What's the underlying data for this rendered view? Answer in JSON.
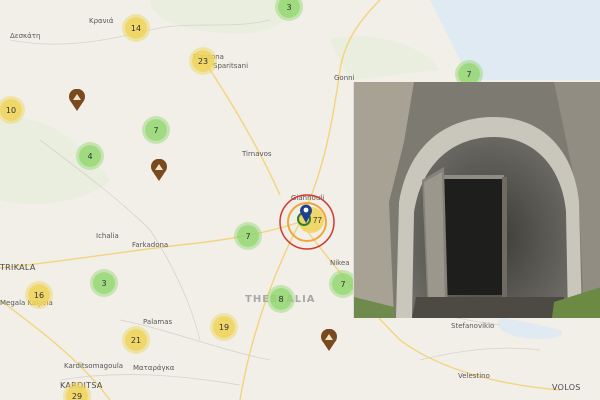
{
  "places": [
    {
      "name": "Κρανιά"
    },
    {
      "name": "Δεσκάτη"
    },
    {
      "name": "Elassona"
    },
    {
      "name": "Sparitsani"
    },
    {
      "name": "Gonni"
    },
    {
      "name": "Tirnavos"
    },
    {
      "name": "Giannouli"
    },
    {
      "name": "Ichalia"
    },
    {
      "name": "Farkadona"
    },
    {
      "name": "TRIKALA"
    },
    {
      "name": "Megala Kalyvia"
    },
    {
      "name": "Nikea"
    },
    {
      "name": "THESSALIA"
    },
    {
      "name": "Palamas"
    },
    {
      "name": "Karditsomagoula"
    },
    {
      "name": "Ματαράγκα"
    },
    {
      "name": "KARDITSA"
    },
    {
      "name": "Stefanovikio"
    },
    {
      "name": "Velestino"
    },
    {
      "name": "VOLOS"
    }
  ],
  "clusters": [
    {
      "count": "3",
      "color": "green"
    },
    {
      "count": "14",
      "color": "yellow"
    },
    {
      "count": "23",
      "color": "yellow"
    },
    {
      "count": "7",
      "color": "green"
    },
    {
      "count": "10",
      "color": "yellow"
    },
    {
      "count": "7",
      "color": "green"
    },
    {
      "count": "4",
      "color": "green"
    },
    {
      "count": "7",
      "color": "green"
    },
    {
      "count": "8",
      "color": "green"
    },
    {
      "count": "7",
      "color": "green"
    },
    {
      "count": "3",
      "color": "green"
    },
    {
      "count": "16",
      "color": "yellow"
    },
    {
      "count": "19",
      "color": "yellow"
    },
    {
      "count": "21",
      "color": "yellow"
    },
    {
      "count": "29",
      "color": "yellow"
    }
  ],
  "selected_cluster": {
    "count": "77",
    "ring_color": "#d03a2f",
    "pin_color": "#1f3f8f"
  },
  "poi_icon": "bunker-marker-icon",
  "colors": {
    "water": "#dfeaf2",
    "land": "#f1efe8",
    "road": "#f5cf6e",
    "poi": "#7a4a1f"
  }
}
